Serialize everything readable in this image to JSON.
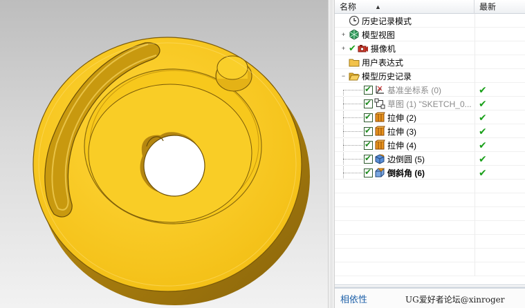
{
  "navigator": {
    "columns": {
      "name": "名称",
      "latest": "最新"
    },
    "sort_arrow": "▲",
    "rows": [
      {
        "label": "历史记录模式",
        "icon": "clock-icon",
        "expander": "",
        "checked": false,
        "latest": "",
        "style": "normal"
      },
      {
        "label": "模型视图",
        "icon": "model-views-icon",
        "expander": "+",
        "checked": false,
        "latest": "",
        "style": "normal"
      },
      {
        "label": "摄像机",
        "icon": "camera-icon",
        "expander": "+",
        "checked": true,
        "latest": "",
        "style": "normal"
      },
      {
        "label": "用户表达式",
        "icon": "folder-icon",
        "expander": "",
        "checked": false,
        "latest": "",
        "style": "normal"
      },
      {
        "label": "模型历史记录",
        "icon": "folder-open-icon",
        "expander": "−",
        "checked": false,
        "latest": "",
        "style": "normal"
      },
      {
        "label": "基准坐标系 (0)",
        "icon": "datum-csys-icon",
        "expander": "",
        "checked": true,
        "latest": "✔",
        "style": "dim"
      },
      {
        "label": "草图 (1) \"SKETCH_0...",
        "icon": "sketch-icon",
        "expander": "",
        "checked": true,
        "latest": "✔",
        "style": "dim"
      },
      {
        "label": "拉伸 (2)",
        "icon": "extrude-icon",
        "expander": "",
        "checked": true,
        "latest": "✔",
        "style": "normal"
      },
      {
        "label": "拉伸 (3)",
        "icon": "extrude-icon",
        "expander": "",
        "checked": true,
        "latest": "✔",
        "style": "normal"
      },
      {
        "label": "拉伸 (4)",
        "icon": "extrude-icon",
        "expander": "",
        "checked": true,
        "latest": "✔",
        "style": "normal"
      },
      {
        "label": "边倒圆 (5)",
        "icon": "edge-blend-icon",
        "expander": "",
        "checked": true,
        "latest": "✔",
        "style": "normal"
      },
      {
        "label": "倒斜角 (6)",
        "icon": "chamfer-icon",
        "expander": "",
        "checked": true,
        "latest": "✔",
        "style": "bold"
      }
    ],
    "footer": {
      "dependency_tab": "相依性",
      "watermark": "UG爱好者论坛@xinroger"
    }
  },
  "colors": {
    "part_face": "#f6c51a",
    "part_dark": "#9c7610",
    "check_green": "#1aa01a",
    "link_blue": "#1c5fa8"
  }
}
